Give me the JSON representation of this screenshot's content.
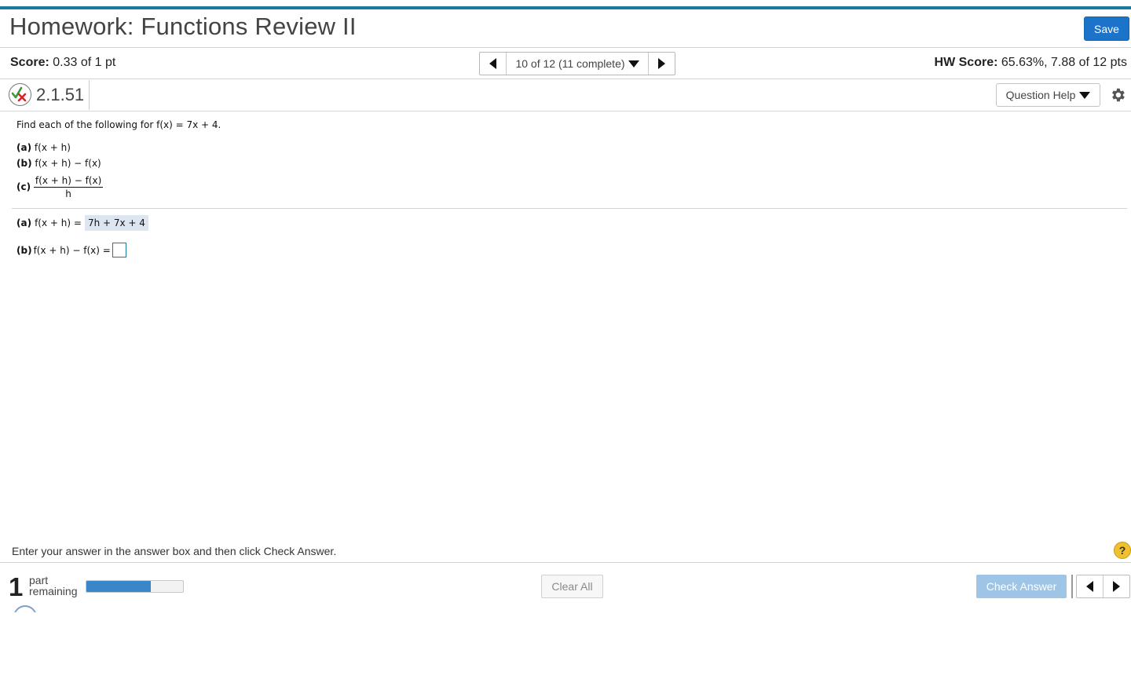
{
  "header": {
    "title": "Homework: Functions Review II",
    "save_label": "Save"
  },
  "status": {
    "score_label": "Score:",
    "score_value": "0.33 of 1 pt",
    "question_nav": "10 of 12 (11 complete)",
    "hw_score_label": "HW Score:",
    "hw_score_value": "65.63%, 7.88 of 12 pts"
  },
  "question": {
    "id": "2.1.51",
    "help_label": "Question Help",
    "prompt": "Find each of the following for f(x) = 7x + 4.",
    "parts": [
      {
        "label": "(a)",
        "expr": "f(x + h)"
      },
      {
        "label": "(b)",
        "expr": "f(x + h) − f(x)"
      },
      {
        "label": "(c)",
        "numerator": "f(x + h) − f(x)",
        "denominator": "h"
      }
    ]
  },
  "answers": {
    "a_label": "(a)",
    "a_expr": "f(x + h) =",
    "a_value": "7h + 7x + 4",
    "b_label": "(b)",
    "b_expr": "f(x + h) − f(x) =",
    "b_value": ""
  },
  "footer": {
    "instruction": "Enter your answer in the answer box and then click Check Answer.",
    "help_glyph": "?",
    "parts_remaining": "1",
    "part_word": "part",
    "remaining_word": "remaining",
    "progress_fraction": 0.67,
    "clear_label": "Clear All",
    "check_label": "Check Answer"
  },
  "colors": {
    "accent": "#1a7a9e",
    "save_button": "#1b74c9",
    "progress_fill": "#3b86c9",
    "check_button": "#9ec4e6",
    "answer_highlight": "#dde5f0"
  },
  "icons": [
    "partial-correct-icon",
    "chevron-left-icon",
    "chevron-right-icon",
    "caret-down-icon",
    "gear-icon",
    "help-icon"
  ]
}
